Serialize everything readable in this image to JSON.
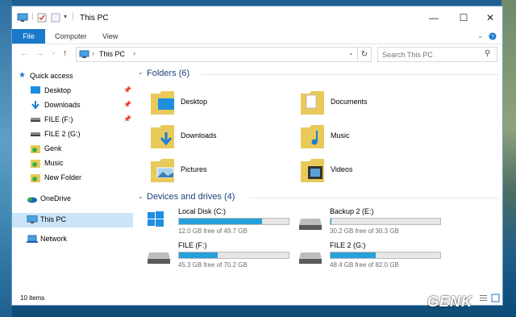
{
  "window": {
    "title": "This PC",
    "controls": {
      "minimize": "—",
      "maximize": "☐",
      "close": "✕"
    }
  },
  "ribbon": {
    "tabs": [
      "File",
      "Computer",
      "View"
    ]
  },
  "address": {
    "location": "This PC",
    "search_placeholder": "Search This PC"
  },
  "nav": {
    "quick_access": "Quick access",
    "items": [
      {
        "label": "Desktop",
        "pinned": true
      },
      {
        "label": "Downloads",
        "pinned": true
      },
      {
        "label": "FILE (F:)",
        "pinned": true
      },
      {
        "label": "FILE 2 (G:)",
        "pinned": false
      },
      {
        "label": "Genk",
        "pinned": false
      },
      {
        "label": "Music",
        "pinned": false
      },
      {
        "label": "New Folder",
        "pinned": false
      }
    ],
    "onedrive": "OneDrive",
    "this_pc": "This PC",
    "network": "Network"
  },
  "folders": {
    "heading": "Folders (6)",
    "items": [
      "Desktop",
      "Documents",
      "Downloads",
      "Music",
      "Pictures",
      "Videos"
    ]
  },
  "drives": {
    "heading": "Devices and drives (4)",
    "items": [
      {
        "name": "Local Disk (C:)",
        "free": "12.0 GB free of 49.7 GB",
        "used_fraction": 0.76,
        "system": true
      },
      {
        "name": "Backup 2 (E:)",
        "free": "30.2 GB free of 30.3 GB",
        "used_fraction": 0.003,
        "system": false
      },
      {
        "name": "FILE (F:)",
        "free": "45.3 GB free of 70.2 GB",
        "used_fraction": 0.35,
        "system": false
      },
      {
        "name": "FILE 2 (G:)",
        "free": "48.4 GB free of 82.0 GB",
        "used_fraction": 0.41,
        "system": false
      }
    ]
  },
  "status": {
    "count": "10 items"
  },
  "watermark": "GENK",
  "colors": {
    "accent": "#1979ca",
    "selected": "#cce4f7",
    "bar_fill": "#26a0da",
    "heading": "#1e3f7a"
  }
}
